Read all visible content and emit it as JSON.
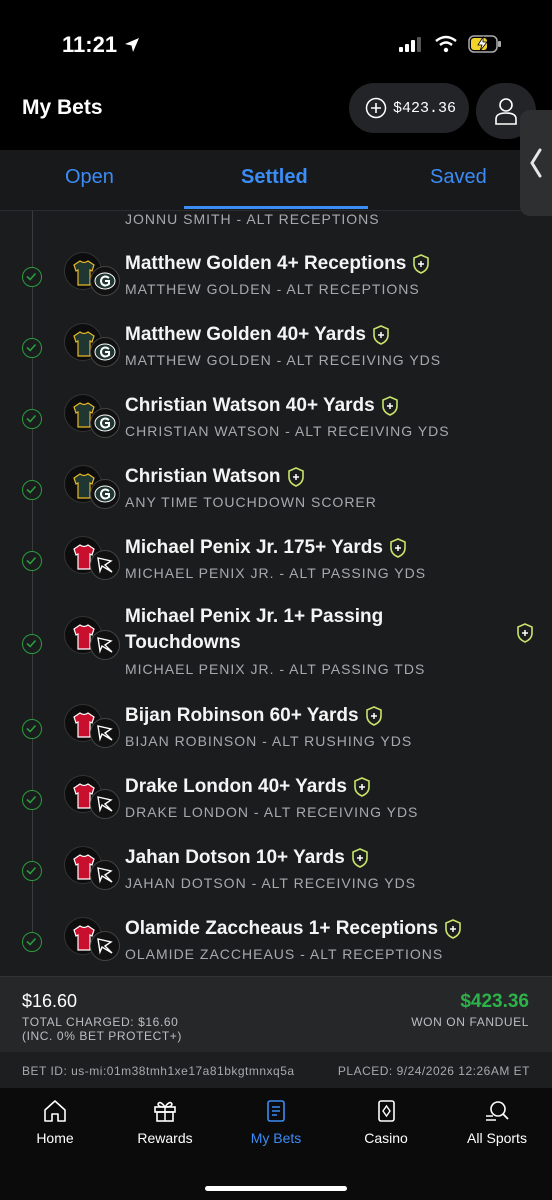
{
  "status_bar": {
    "time": "11:21"
  },
  "header": {
    "title": "My Bets",
    "balance": "$423.36"
  },
  "tabs": [
    {
      "label": "Open",
      "active": false
    },
    {
      "label": "Settled",
      "active": true
    },
    {
      "label": "Saved",
      "active": false
    }
  ],
  "partial_leg_sub": "JONNU SMITH - ALT RECEPTIONS",
  "legs": [
    {
      "title": "Matthew Golden 4+ Receptions",
      "sub": "MATTHEW GOLDEN - ALT RECEPTIONS",
      "team": "packers"
    },
    {
      "title": "Matthew Golden 40+ Yards",
      "sub": "MATTHEW GOLDEN - ALT RECEIVING YDS",
      "team": "packers"
    },
    {
      "title": "Christian Watson 40+ Yards",
      "sub": "CHRISTIAN WATSON - ALT RECEIVING YDS",
      "team": "packers"
    },
    {
      "title": "Christian Watson",
      "sub": "ANY TIME TOUCHDOWN SCORER",
      "team": "packers"
    },
    {
      "title": "Michael Penix Jr. 175+ Yards",
      "sub": "MICHAEL PENIX JR. - ALT PASSING YDS",
      "team": "falcons"
    },
    {
      "title": "Michael Penix Jr. 1+ Passing Touchdowns",
      "sub": "MICHAEL PENIX JR. - ALT PASSING TDS",
      "team": "falcons"
    },
    {
      "title": "Bijan Robinson 60+ Yards",
      "sub": "BIJAN ROBINSON - ALT RUSHING YDS",
      "team": "falcons"
    },
    {
      "title": "Drake London 40+ Yards",
      "sub": "DRAKE LONDON - ALT RECEIVING YDS",
      "team": "falcons"
    },
    {
      "title": "Jahan Dotson 10+ Yards",
      "sub": "JAHAN DOTSON - ALT RECEIVING YDS",
      "team": "falcons"
    },
    {
      "title": "Olamide Zaccheaus 1+ Receptions",
      "sub": "OLAMIDE ZACCHEAUS - ALT RECEPTIONS",
      "team": "falcons"
    }
  ],
  "summary": {
    "stake": "$16.60",
    "total_charged": "TOTAL CHARGED: $16.60",
    "bet_protect": "(INC. 0% BET PROTECT+)",
    "won_amount": "$423.36",
    "won_label": "WON ON FANDUEL"
  },
  "bet_info": {
    "bet_id": "BET ID: us-mi:01m38tmh1xe17a81bkgtmnxq5a",
    "placed": "PLACED: 9/24/2026 12:26AM ET"
  },
  "nav": [
    {
      "label": "Home",
      "icon": "home-icon"
    },
    {
      "label": "Rewards",
      "icon": "gift-icon"
    },
    {
      "label": "My Bets",
      "icon": "bet-slip-icon",
      "active": true
    },
    {
      "label": "Casino",
      "icon": "cards-icon"
    },
    {
      "label": "All Sports",
      "icon": "search-sports-icon"
    }
  ],
  "colors": {
    "accent": "#3b8cf5",
    "win": "#2db24a",
    "check": "#2a9d3c",
    "packers": "#203731",
    "falcons": "#c8102e",
    "shield": "#c7e36a"
  }
}
